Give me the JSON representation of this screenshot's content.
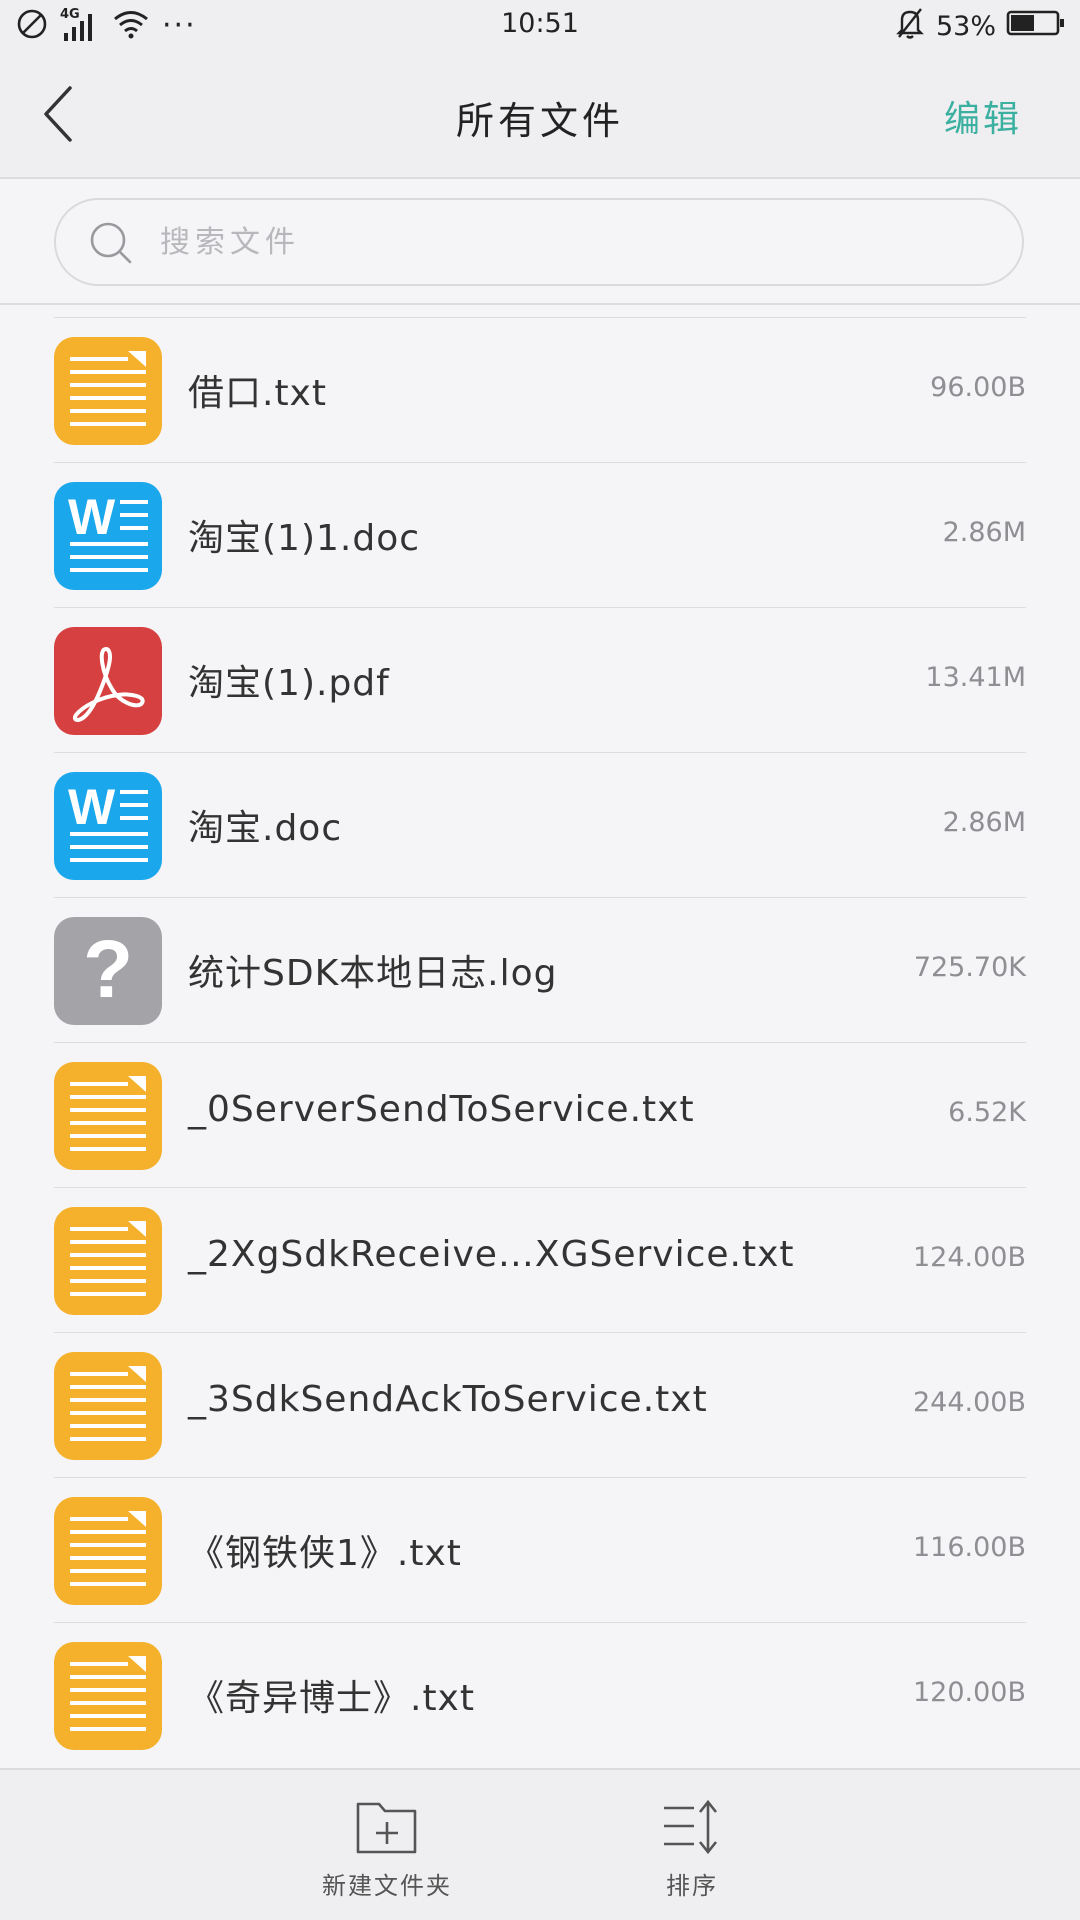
{
  "status_bar": {
    "network": "4G",
    "time": "10:51",
    "battery": "53%",
    "battery_level": 0.53
  },
  "header": {
    "title": "所有文件",
    "edit_label": "编辑"
  },
  "search": {
    "placeholder": "搜索文件",
    "value": ""
  },
  "files": [
    {
      "name": "借口.txt",
      "size": "96.00B",
      "icon": "txt-file-icon",
      "color": "#f5b02c"
    },
    {
      "name": "淘宝(1)1.doc",
      "size": "2.86M",
      "icon": "word-file-icon",
      "color": "#1aa7ec"
    },
    {
      "name": "淘宝(1).pdf",
      "size": "13.41M",
      "icon": "pdf-file-icon",
      "color": "#d64040"
    },
    {
      "name": "淘宝.doc",
      "size": "2.86M",
      "icon": "word-file-icon",
      "color": "#1aa7ec"
    },
    {
      "name": "统计SDK本地日志.log",
      "size": "725.70K",
      "icon": "unknown-file-icon",
      "color": "#a3a3a8"
    },
    {
      "name": "_0ServerSendToService.txt",
      "size": "6.52K",
      "icon": "txt-file-icon",
      "color": "#f5b02c"
    },
    {
      "name": "_2XgSdkReceive…XGService.txt",
      "size": "124.00B",
      "icon": "txt-file-icon",
      "color": "#f5b02c"
    },
    {
      "name": "_3SdkSendAckToService.txt",
      "size": "244.00B",
      "icon": "txt-file-icon",
      "color": "#f5b02c"
    },
    {
      "name": "《钢铁侠1》.txt",
      "size": "116.00B",
      "icon": "txt-file-icon",
      "color": "#f5b02c"
    },
    {
      "name": "《奇异博士》.txt",
      "size": "120.00B",
      "icon": "txt-file-icon",
      "color": "#f5b02c"
    }
  ],
  "bottom_bar": {
    "new_folder_label": "新建文件夹",
    "sort_label": "排序"
  },
  "colors": {
    "accent": "#3bb0a0"
  }
}
